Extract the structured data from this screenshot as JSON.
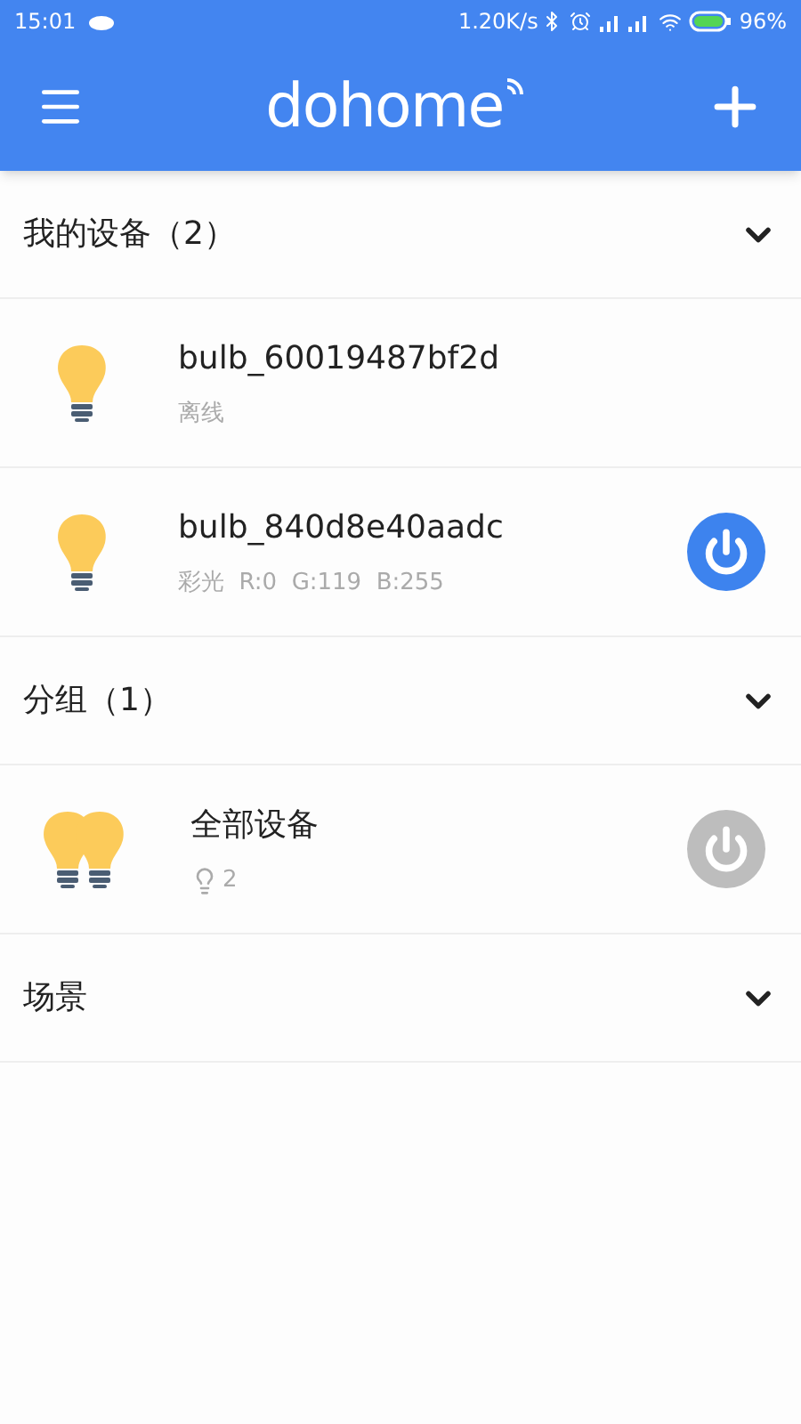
{
  "status_bar": {
    "time": "15:01",
    "speed": "1.20K/s",
    "battery": "96%"
  },
  "app_bar": {
    "logo": "dohome"
  },
  "sections": [
    {
      "title": "我的设备（2）",
      "items": [
        {
          "kind": "bulb",
          "name": "bulb_60019487bf2d",
          "status": "离线"
        },
        {
          "kind": "bulb",
          "name": "bulb_840d8e40aadc",
          "status": "彩光  R:0  G:119  B:255",
          "on": true
        }
      ]
    },
    {
      "title": "分组（1）",
      "items": [
        {
          "kind": "group",
          "name": "全部设备",
          "count": "2",
          "on": false
        }
      ]
    },
    {
      "title": "场景"
    }
  ]
}
